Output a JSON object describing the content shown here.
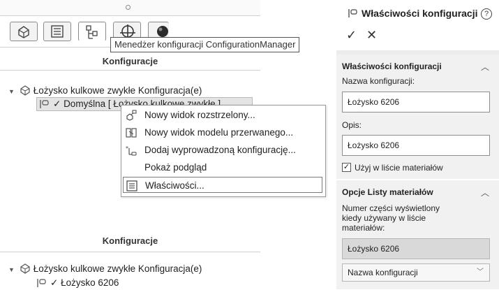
{
  "tooltip": "Menedżer konfiguracji ConfigurationManager",
  "tabs": [
    {
      "icon": "feature-manager-icon"
    },
    {
      "icon": "property-manager-icon"
    },
    {
      "icon": "configuration-manager-icon"
    },
    {
      "icon": "dimxpert-manager-icon"
    },
    {
      "icon": "display-manager-icon"
    }
  ],
  "top_panel": {
    "title": "Konfiguracje",
    "root_label": "Łożysko kulkowe zwykłe Konfiguracja(e)",
    "default_config_label": "Domyślna [ Łożysko kulkowe zwykłe ]"
  },
  "context_menu": {
    "items": [
      {
        "label": "Nowy widok rozstrzelony...",
        "icon": "exploded-view-icon"
      },
      {
        "label": "Nowy widok modelu przerwanego...",
        "icon": "break-view-icon"
      },
      {
        "label": "Dodaj wyprowadzoną konfigurację...",
        "icon": "derived-config-icon"
      },
      {
        "label": "Pokaż podgląd",
        "icon": ""
      },
      {
        "label": "Właściwości...",
        "icon": "properties-icon"
      }
    ]
  },
  "bottom_panel": {
    "title": "Konfiguracje",
    "root_label": "Łożysko kulkowe zwykłe Konfiguracja(e)",
    "config_label": "Łożysko 6206"
  },
  "property_manager": {
    "title": "Właściwości konfiguracji",
    "help_icon": "?",
    "ok_icon": "✓",
    "cancel_icon": "✕",
    "section1": {
      "title": "Właściwości konfiguracji",
      "name_label": "Nazwa konfiguracji:",
      "name_value": "Łożysko 6206",
      "desc_label": "Opis:",
      "desc_value": "Łożysko 6206",
      "bom_checkbox_label": "Użyj w liście materiałów",
      "bom_checked": true
    },
    "section2": {
      "title": "Opcje Listy materiałów",
      "part_number_label_1": "Numer części wyświetlony",
      "part_number_label_2": "kiedy używany w liście",
      "part_number_label_3": "materiałów:",
      "part_number_value": "Łożysko 6206",
      "source_select": "Nazwa konfiguracji"
    }
  }
}
